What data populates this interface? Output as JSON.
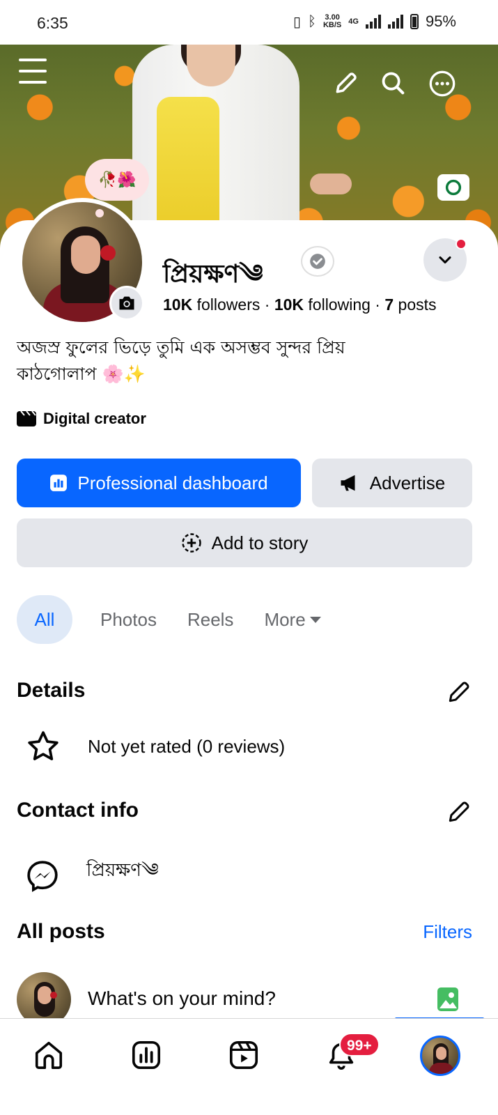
{
  "status_bar": {
    "time": "6:35",
    "net_speed_value": "3.00",
    "net_speed_unit": "KB/S",
    "network": "4G",
    "battery": "95%"
  },
  "cover": {
    "note_emoji": "🥀🌺"
  },
  "profile": {
    "name": "প্রিয়ক্ষণ༄",
    "followers_count": "10K",
    "followers_label": "followers",
    "following_count": "10K",
    "following_label": "following",
    "posts_count": "7",
    "posts_label": "posts",
    "separator": "·",
    "bio": "অজস্র ফুলের ভিড়ে তুমি এক অসম্ভব সুন্দর প্রিয় কাঠগোলাপ 🌸✨",
    "category": "Digital creator"
  },
  "actions": {
    "dashboard_label": "Professional dashboard",
    "advertise_label": "Advertise",
    "add_story_label": "Add to story"
  },
  "tabs": {
    "all": "All",
    "photos": "Photos",
    "reels": "Reels",
    "more": "More"
  },
  "details": {
    "title": "Details",
    "rating": "Not yet rated (0 reviews)"
  },
  "contact": {
    "title": "Contact info",
    "messenger": "প্রিয়ক্ষণ༄"
  },
  "posts": {
    "title": "All posts",
    "filters": "Filters",
    "composer_placeholder": "What's on your mind?"
  },
  "bottom_nav": {
    "notifications_badge": "99+"
  },
  "colors": {
    "accent": "#0866ff",
    "badge_red": "#e41e3f",
    "button_gray": "#e4e6eb"
  }
}
